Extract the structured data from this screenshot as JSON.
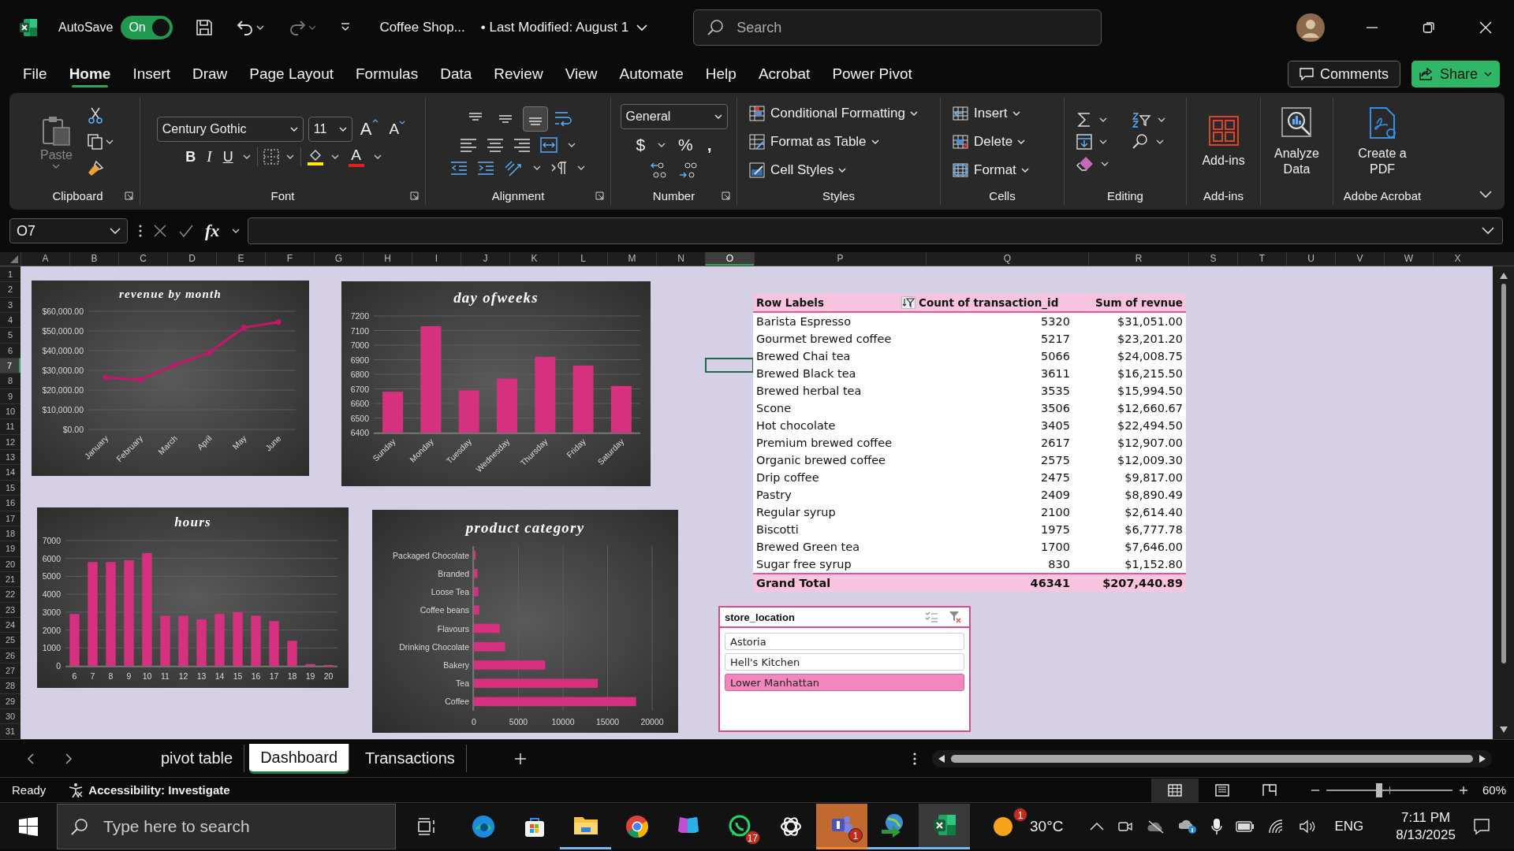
{
  "title_bar": {
    "autosave_label": "AutoSave",
    "autosave": {
      "label": "On",
      "on": true
    },
    "file_name": "Coffee Shop...",
    "modified": "• Last Modified: August 1",
    "search": {
      "placeholder": "Search"
    }
  },
  "menu_tabs": [
    {
      "label": "File",
      "selected": false
    },
    {
      "label": "Home",
      "selected": true
    },
    {
      "label": "Insert",
      "selected": false
    },
    {
      "label": "Draw",
      "selected": false
    },
    {
      "label": "Page Layout",
      "selected": false
    },
    {
      "label": "Formulas",
      "selected": false
    },
    {
      "label": "Data",
      "selected": false
    },
    {
      "label": "Review",
      "selected": false
    },
    {
      "label": "View",
      "selected": false
    },
    {
      "label": "Automate",
      "selected": false
    },
    {
      "label": "Help",
      "selected": false
    },
    {
      "label": "Acrobat",
      "selected": false
    },
    {
      "label": "Power Pivot",
      "selected": false
    }
  ],
  "comments_button": "Comments",
  "share_button": "Share",
  "ribbon": {
    "clipboard": {
      "label": "Clipboard",
      "paste": {
        "label": "Paste",
        "disabled": true
      }
    },
    "font": {
      "label": "Font",
      "family": "Century Gothic",
      "size": "11",
      "grow": "A",
      "shrink": "A",
      "bold": "B",
      "italic": "I",
      "underline": "U",
      "font_color_label": "A"
    },
    "alignment": {
      "label": "Alignment",
      "vertical": [
        {
          "kind": "top",
          "selected": false
        },
        {
          "kind": "middle",
          "selected": false
        },
        {
          "kind": "bottom",
          "selected": true
        }
      ]
    },
    "number": {
      "label": "Number",
      "format": "General",
      "currency": "$",
      "percent": "%",
      "comma": ","
    },
    "styles": {
      "label": "Styles",
      "items": [
        {
          "kind": "conditional",
          "label": "Conditional Formatting"
        },
        {
          "kind": "table",
          "label": "Format as Table"
        },
        {
          "kind": "cell",
          "label": "Cell Styles"
        }
      ]
    },
    "cells": {
      "label": "Cells",
      "items": [
        {
          "kind": "insert",
          "label": "Insert"
        },
        {
          "kind": "delete",
          "label": "Delete"
        },
        {
          "kind": "format",
          "label": "Format"
        }
      ]
    },
    "editing": {
      "label": "Editing"
    },
    "addins": {
      "label": "Add-ins",
      "button": "Add-ins"
    },
    "analyze": {
      "button": "Analyze Data"
    },
    "acrobat": {
      "label": "Adobe Acrobat",
      "button": "Create a PDF"
    }
  },
  "formula_bar": {
    "name_box": "O7",
    "function_label": "fx"
  },
  "sheet": {
    "columns": [
      {
        "label": "A",
        "selected": false
      },
      {
        "label": "B",
        "selected": false
      },
      {
        "label": "C",
        "selected": false
      },
      {
        "label": "D",
        "selected": false
      },
      {
        "label": "E",
        "selected": false
      },
      {
        "label": "F",
        "selected": false
      },
      {
        "label": "G",
        "selected": false
      },
      {
        "label": "H",
        "selected": false
      },
      {
        "label": "I",
        "selected": false
      },
      {
        "label": "J",
        "selected": false
      },
      {
        "label": "K",
        "selected": false
      },
      {
        "label": "L",
        "selected": false
      },
      {
        "label": "M",
        "selected": false
      },
      {
        "label": "N",
        "selected": false
      },
      {
        "label": "O",
        "selected": true
      },
      {
        "label": "P",
        "selected": false
      },
      {
        "label": "Q",
        "selected": false
      },
      {
        "label": "R",
        "selected": false
      },
      {
        "label": "S",
        "selected": false
      },
      {
        "label": "T",
        "selected": false
      },
      {
        "label": "U",
        "selected": false
      },
      {
        "label": "V",
        "selected": false
      },
      {
        "label": "W",
        "selected": false
      },
      {
        "label": "X",
        "selected": false
      }
    ],
    "rows": [
      {
        "label": "1",
        "selected": false
      },
      {
        "label": "2",
        "selected": false
      },
      {
        "label": "3",
        "selected": false
      },
      {
        "label": "4",
        "selected": false
      },
      {
        "label": "5",
        "selected": false
      },
      {
        "label": "6",
        "selected": false
      },
      {
        "label": "7",
        "selected": true
      },
      {
        "label": "8",
        "selected": false
      },
      {
        "label": "9",
        "selected": false
      },
      {
        "label": "10",
        "selected": false
      },
      {
        "label": "11",
        "selected": false
      },
      {
        "label": "12",
        "selected": false
      },
      {
        "label": "13",
        "selected": false
      },
      {
        "label": "14",
        "selected": false
      },
      {
        "label": "15",
        "selected": false
      },
      {
        "label": "16",
        "selected": false
      },
      {
        "label": "17",
        "selected": false
      },
      {
        "label": "18",
        "selected": false
      },
      {
        "label": "19",
        "selected": false
      },
      {
        "label": "20",
        "selected": false
      },
      {
        "label": "21",
        "selected": false
      },
      {
        "label": "22",
        "selected": false
      },
      {
        "label": "23",
        "selected": false
      },
      {
        "label": "24",
        "selected": false
      },
      {
        "label": "25",
        "selected": false
      },
      {
        "label": "26",
        "selected": false
      },
      {
        "label": "27",
        "selected": false
      },
      {
        "label": "28",
        "selected": false
      },
      {
        "label": "29",
        "selected": false
      },
      {
        "label": "30",
        "selected": false
      },
      {
        "label": "31",
        "selected": false
      }
    ]
  },
  "charts": [
    {
      "chart_data": {
        "type": "line",
        "title": "revenue by month",
        "categories": [
          "January",
          "February",
          "March",
          "April",
          "May",
          "June"
        ],
        "grid": true,
        "series": [
          {
            "color": "#c2186a",
            "marker": "circle",
            "values": [
              26400,
              25200,
              32600,
              39100,
              51700,
              54500
            ]
          }
        ],
        "ylim": [
          0,
          60000
        ],
        "yticks": [
          {
            "value": 0,
            "label": "$0.00"
          },
          {
            "value": 10000,
            "label": "$10,000.00"
          },
          {
            "value": 20000,
            "label": "$20,000.00"
          },
          {
            "value": 30000,
            "label": "$30,000.00"
          },
          {
            "value": 40000,
            "label": "$40,000.00"
          },
          {
            "value": 50000,
            "label": "$50,000.00"
          },
          {
            "value": 60000,
            "label": "$60,000.00"
          }
        ]
      }
    },
    {
      "chart_data": {
        "type": "bar",
        "title": "day ofweeks",
        "categories": [
          "Sunday",
          "Monday",
          "Tuesday",
          "Wednesday",
          "Thursday",
          "Friday",
          "Saturday"
        ],
        "grid": true,
        "series": [
          {
            "color": "#d6317f",
            "values": [
              6680,
              7130,
              6690,
              6770,
              6920,
              6860,
              6720
            ]
          }
        ],
        "ylim": [
          6400,
          7200
        ],
        "yticks": [
          6400,
          6500,
          6600,
          6700,
          6800,
          6900,
          7000,
          7100,
          7200
        ]
      }
    },
    {
      "chart_data": {
        "type": "bar",
        "title": "hours",
        "categories": [
          "6",
          "7",
          "8",
          "9",
          "10",
          "11",
          "12",
          "13",
          "14",
          "15",
          "16",
          "17",
          "18",
          "19",
          "20"
        ],
        "grid": true,
        "series": [
          {
            "color": "#d6317f",
            "values": [
              2900,
              5800,
              5800,
              5900,
              6300,
              2800,
              2800,
              2600,
              2900,
              3000,
              2800,
              2500,
              1400,
              100,
              50
            ]
          }
        ],
        "ylim": [
          0,
          7000
        ],
        "yticks": [
          0,
          1000,
          2000,
          3000,
          4000,
          5000,
          6000,
          7000
        ]
      }
    },
    {
      "chart_data": {
        "type": "bar",
        "orientation": "horizontal",
        "title": "product category",
        "categories": [
          "Packaged Chocolate",
          "Branded",
          "Loose Tea",
          "Coffee beans",
          "Flavours",
          "Drinking Chocolate",
          "Bakery",
          "Tea",
          "Coffee"
        ],
        "grid": true,
        "series": [
          {
            "color": "#d6317f",
            "values": [
              200,
              400,
              500,
              600,
              2900,
              3500,
              8000,
              13900,
              18200
            ]
          }
        ],
        "xlim": [
          0,
          20000
        ],
        "xticks": [
          0,
          5000,
          10000,
          15000,
          20000
        ]
      }
    }
  ],
  "pivot": {
    "headers": [
      "Row Labels",
      "Count of transaction_id",
      "Sum of revnue"
    ],
    "rows": [
      [
        "Barista Espresso",
        "5320",
        "$31,051.00"
      ],
      [
        "Gourmet brewed coffee",
        "5217",
        "$23,201.20"
      ],
      [
        "Brewed Chai tea",
        "5066",
        "$24,008.75"
      ],
      [
        "Brewed Black tea",
        "3611",
        "$16,215.50"
      ],
      [
        "Brewed herbal tea",
        "3535",
        "$15,994.50"
      ],
      [
        "Scone",
        "3506",
        "$12,660.67"
      ],
      [
        "Hot chocolate",
        "3405",
        "$22,494.50"
      ],
      [
        "Premium brewed coffee",
        "2617",
        "$12,907.00"
      ],
      [
        "Organic brewed coffee",
        "2575",
        "$12,009.30"
      ],
      [
        "Drip coffee",
        "2475",
        "$9,817.00"
      ],
      [
        "Pastry",
        "2409",
        "$8,890.49"
      ],
      [
        "Regular syrup",
        "2100",
        "$2,614.40"
      ],
      [
        "Biscotti",
        "1975",
        "$6,777.78"
      ],
      [
        "Brewed Green tea",
        "1700",
        "$7,646.00"
      ],
      [
        "Sugar free syrup",
        "830",
        "$1,152.80"
      ]
    ],
    "total": [
      "Grand Total",
      "46341",
      "$207,440.89"
    ]
  },
  "slicer": {
    "title": "store_location",
    "items": [
      {
        "label": "Astoria",
        "selected": false
      },
      {
        "label": "Hell's Kitchen",
        "selected": false
      },
      {
        "label": "Lower Manhattan",
        "selected": true
      }
    ]
  },
  "sheet_tabs": [
    {
      "label": "pivot table",
      "selected": false
    },
    {
      "label": "Dashboard",
      "selected": true
    },
    {
      "label": "Transactions",
      "selected": false
    }
  ],
  "status_bar": {
    "ready": "Ready",
    "accessibility": "Accessibility: Investigate",
    "views": [
      {
        "kind": "normal",
        "selected": true
      },
      {
        "kind": "page_layout",
        "selected": false
      },
      {
        "kind": "page_break",
        "selected": false
      }
    ],
    "zoom": {
      "level": 0.42,
      "reading": "60%"
    }
  },
  "taskbar": {
    "search": {
      "placeholder": "Type here to search"
    },
    "apps": [
      {
        "kind": "edge",
        "running": false,
        "active": false,
        "attention": false
      },
      {
        "kind": "store",
        "running": false,
        "active": false,
        "attention": false
      },
      {
        "kind": "folder",
        "running": true,
        "active": false,
        "attention": false
      },
      {
        "kind": "chrome",
        "running": false,
        "active": false,
        "attention": false
      },
      {
        "kind": "m365",
        "running": false,
        "active": false,
        "attention": false
      },
      {
        "kind": "chat",
        "running": false,
        "active": false,
        "attention": false,
        "badge": "17"
      },
      {
        "kind": "knot",
        "running": false,
        "active": false,
        "attention": false
      },
      {
        "kind": "teams",
        "running": true,
        "active": false,
        "attention": true,
        "badge": "1"
      },
      {
        "kind": "download",
        "running": true,
        "active": false,
        "attention": false
      },
      {
        "kind": "excel",
        "running": true,
        "active": true,
        "attention": false
      }
    ],
    "weather": {
      "badge": "1",
      "temperature": "30°C"
    },
    "language": "ENG",
    "time": "7:11 PM",
    "date": "8/13/2025"
  }
}
